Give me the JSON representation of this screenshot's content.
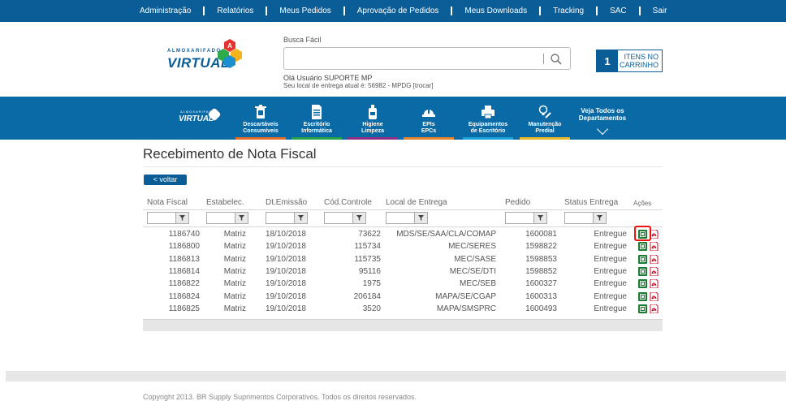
{
  "topnav": [
    "Administração",
    "Relatórios",
    "Meus Pedidos",
    "Aprovação de Pedidos",
    "Meus Downloads",
    "Tracking",
    "SAC",
    "Sair"
  ],
  "logo": {
    "small": "ALMOXARIFADO",
    "big": "VIRTUAL",
    "cube_letter": "A"
  },
  "search": {
    "label": "Busca Fácil",
    "value": "",
    "placeholder": ""
  },
  "welcome": {
    "greeting": "Olá Usuário SUPORTE MP",
    "delivery": "Seu local de entrega atual é: 56982 - MPDG [trocar]"
  },
  "cart": {
    "count": "1",
    "label_line1": "ITENS NO",
    "label_line2": "CARRINHO"
  },
  "categories": [
    {
      "line1": "Descartáveis",
      "line2": "Consumíveis",
      "color": "#e36b2c"
    },
    {
      "line1": "Escritório",
      "line2": "Informática",
      "color": "#26a248"
    },
    {
      "line1": "Higiene",
      "line2": "Limpeza",
      "color": "#8f2d87"
    },
    {
      "line1": "EPIs",
      "line2": "EPCs",
      "color": "#e8832d"
    },
    {
      "line1": "Equipamentos",
      "line2": "de Escritório",
      "color": "#1aa3d9"
    },
    {
      "line1": "Manutenção",
      "line2": "Predial",
      "color": "#e7b829"
    }
  ],
  "catlogo": {
    "small": "ALMOXARIFADO",
    "big": "VIRTUAL"
  },
  "veja": {
    "line1": "Veja Todos os",
    "line2": "Departamentos"
  },
  "page": {
    "title": "Recebimento de Nota Fiscal",
    "back_label": "< voltar"
  },
  "table": {
    "headers": [
      "Nota Fiscal",
      "Estabelec.",
      "Dt.Emissão",
      "Cód.Controle",
      "Local de Entrega",
      "Pedido",
      "Status Entrega",
      "Ações"
    ],
    "rows": [
      [
        "1186740",
        "Matriz",
        "18/10/2018",
        "73622",
        "MDS/SE/SAA/CLA/COMAP",
        "1600081",
        "Entregue"
      ],
      [
        "1186800",
        "Matriz",
        "19/10/2018",
        "115734",
        "MEC/SERES",
        "1598822",
        "Entregue"
      ],
      [
        "1186813",
        "Matriz",
        "19/10/2018",
        "115735",
        "MEC/SASE",
        "1598853",
        "Entregue"
      ],
      [
        "1186814",
        "Matriz",
        "19/10/2018",
        "95116",
        "MEC/SE/DTI",
        "1598852",
        "Entregue"
      ],
      [
        "1186822",
        "Matriz",
        "19/10/2018",
        "1975",
        "MEC/SEB",
        "1600327",
        "Entregue"
      ],
      [
        "1186824",
        "Matriz",
        "19/10/2018",
        "206184",
        "MAPA/SE/CGAP",
        "1600313",
        "Entregue"
      ],
      [
        "1186825",
        "Matriz",
        "19/10/2018",
        "3520",
        "MAPA/SMSPRC",
        "1600493",
        "Entregue"
      ]
    ]
  },
  "footer": {
    "copyright": "Copyright 2013. BR Supply Suprimentos Corporativos. Todos os direitos reservados."
  },
  "colors": {
    "primary": "#0a5d96",
    "nav": "#0a6aa6",
    "highlight": "#e11111",
    "excel": "#1e7b34",
    "pdf": "#c8102e"
  }
}
